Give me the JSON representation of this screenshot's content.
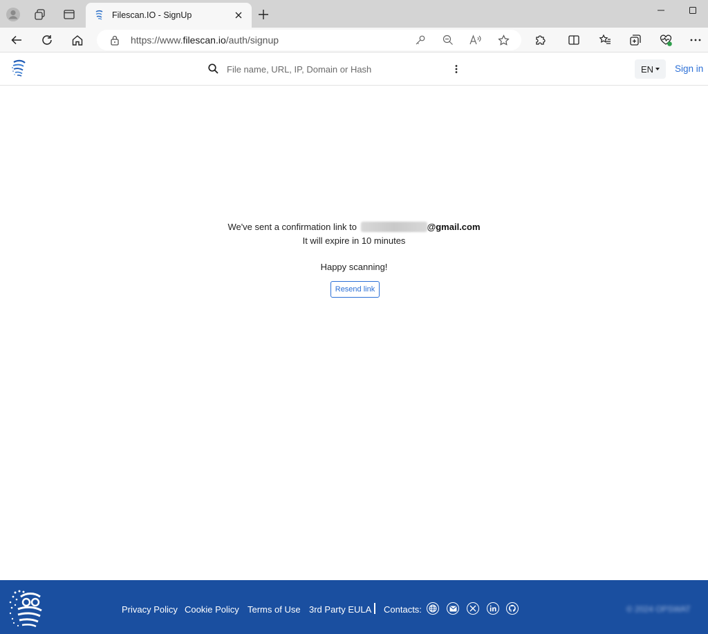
{
  "browser": {
    "tab_title": "Filescan.IO - SignUp",
    "url_prefix": "https://www.",
    "url_host": "filescan.io",
    "url_path": "/auth/signup"
  },
  "header": {
    "search_placeholder": "File name, URL, IP, Domain or Hash",
    "language": "EN",
    "signin_label": "Sign in"
  },
  "main": {
    "sent_text": "We've sent a confirmation link to",
    "email_domain": "@gmail.com",
    "expire_text": "It will expire in 10 minutes",
    "happy_text": "Happy scanning!",
    "resend_label": "Resend link"
  },
  "footer": {
    "links": [
      "Privacy Policy",
      "Cookie Policy",
      "Terms of Use",
      "3rd Party EULA"
    ],
    "contacts_label": "Contacts:",
    "social_icons": [
      "globe-icon",
      "mail-icon",
      "x-icon",
      "linkedin-icon",
      "github-icon"
    ],
    "copyright": "© 2024 OPSWAT"
  },
  "colors": {
    "accent": "#2b6fd6",
    "footer_bg": "#1a4fa0",
    "tabstrip_bg": "#d4d4d4"
  }
}
